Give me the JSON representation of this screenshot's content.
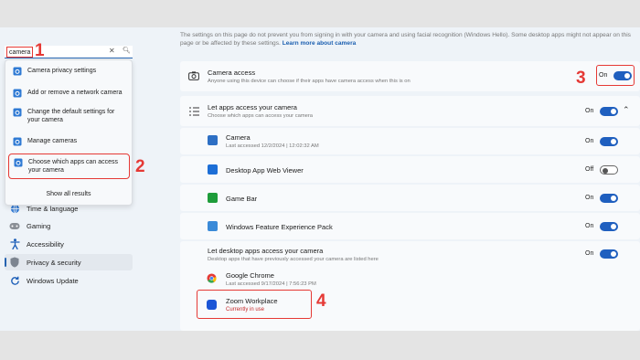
{
  "search": {
    "query": "camera",
    "results": [
      {
        "label": "Camera privacy settings"
      },
      {
        "label": "Add or remove a network camera"
      },
      {
        "label": "Change the default settings for your camera"
      },
      {
        "label": "Manage cameras"
      },
      {
        "label": "Choose which apps can access your camera"
      }
    ],
    "show_all": "Show all results"
  },
  "nav": {
    "items": [
      {
        "label": "Time & language",
        "icon": "globe-icon"
      },
      {
        "label": "Gaming",
        "icon": "gamepad-icon"
      },
      {
        "label": "Accessibility",
        "icon": "accessibility-icon"
      },
      {
        "label": "Privacy & security",
        "icon": "shield-icon",
        "active": true
      },
      {
        "label": "Windows Update",
        "icon": "update-icon"
      }
    ]
  },
  "main": {
    "top_text": "The settings on this page do not prevent you from signing in with your camera and using facial recognition (Windows Hello). Some desktop apps might not appear on this page or be affected by these settings.",
    "learn_more": "Learn more about camera",
    "camera_access": {
      "title": "Camera access",
      "subtitle": "Anyone using this device can choose if their apps have camera access when this is on",
      "state": "On"
    },
    "let_apps": {
      "title": "Let apps access your camera",
      "subtitle": "Choose which apps can access your camera",
      "state": "On"
    },
    "apps": [
      {
        "name": "Camera",
        "detail": "Last accessed 12/2/2024  |  12:02:32 AM",
        "state": "On"
      },
      {
        "name": "Desktop App Web Viewer",
        "detail": "",
        "state": "Off"
      },
      {
        "name": "Game Bar",
        "detail": "",
        "state": "On"
      },
      {
        "name": "Windows Feature Experience Pack",
        "detail": "",
        "state": "On"
      }
    ],
    "desktop_apps": {
      "title": "Let desktop apps access your camera",
      "subtitle": "Desktop apps that have previously accessed your camera are listed here",
      "state": "On"
    },
    "desktop_list": [
      {
        "name": "Google Chrome",
        "detail": "Last accessed 9/17/2024  |  7:56:23 PM"
      },
      {
        "name": "Zoom Workplace",
        "detail": "Currently in use"
      }
    ]
  },
  "annotations": [
    "1",
    "2",
    "3",
    "4"
  ],
  "colors": {
    "accent": "#1f5fbf",
    "highlight": "#e53935"
  }
}
